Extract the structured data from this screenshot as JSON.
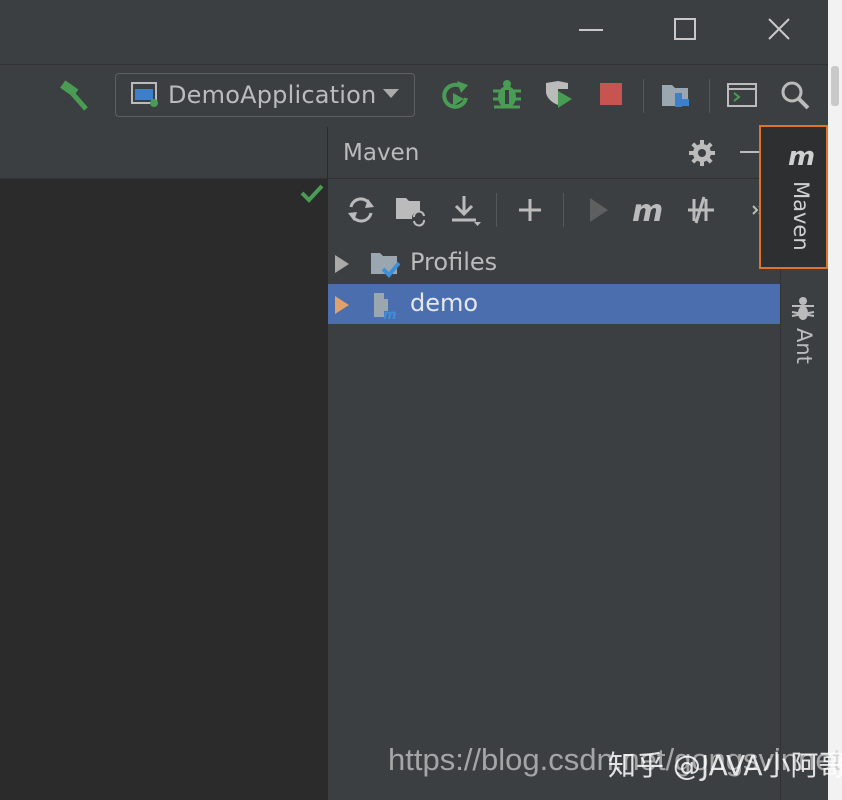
{
  "window": {
    "minimize_icon": "minimize-icon",
    "maximize_icon": "maximize-icon",
    "close_icon": "close-icon"
  },
  "toolbar": {
    "build_icon": "hammer-icon",
    "run_config": {
      "label": "DemoApplication",
      "icon": "app-window-icon",
      "dropdown_icon": "dropdown-arrow-icon"
    },
    "actions": [
      "rerun-icon",
      "debug-bug-icon",
      "coverage-icon",
      "stop-icon",
      "project-structure-icon",
      "terminal-window-icon",
      "search-icon"
    ],
    "colors": {
      "green": "#499c54",
      "stop": "#c75450"
    }
  },
  "editor": {
    "status_icon": "checkmark-icon"
  },
  "maven": {
    "title": "Maven",
    "header_actions": [
      "gear-icon",
      "hide-icon"
    ],
    "toolbar": [
      "reload-icon",
      "generate-sources-icon",
      "download-icon",
      "add-icon",
      "run-icon",
      "execute-goal-icon",
      "skip-tests-icon",
      "more-icon"
    ],
    "tree": [
      {
        "label": "Profiles",
        "icon": "profiles-folder-icon",
        "selected": false
      },
      {
        "label": "demo",
        "icon": "maven-module-icon",
        "selected": true
      }
    ],
    "selection_color": "#4b6eaf"
  },
  "side_tabs": [
    {
      "label": "Maven",
      "icon": "maven-m-icon",
      "highlighted": true,
      "highlight_color": "#e0732a"
    },
    {
      "label": "Ant",
      "icon": "ant-icon",
      "highlighted": false
    }
  ],
  "watermark": {
    "url": "https://blog.csdn.net/gongsvinnet",
    "zhihu": "知乎 @JAVA小阿哥"
  }
}
